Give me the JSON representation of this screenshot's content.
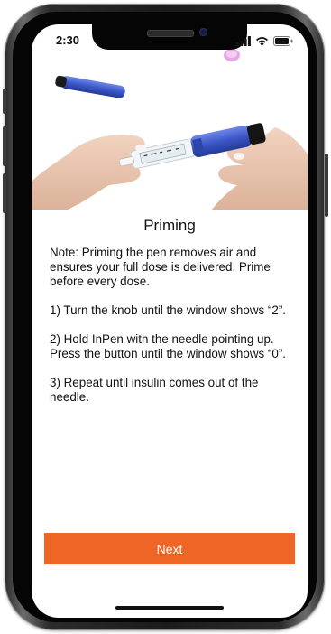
{
  "status_bar": {
    "time": "2:30",
    "signal_icon": "cellular-signal-icon",
    "wifi_icon": "wifi-icon",
    "battery_icon": "battery-icon"
  },
  "hero": {
    "image_description_icon": "insulin-pen-priming-photo"
  },
  "page": {
    "title": "Priming",
    "note": "Note: Priming the pen removes air and ensures your full dose is delivered. Prime before every dose.",
    "steps": [
      "1) Turn the knob until the window shows “2”.",
      "2) Hold InPen with the needle pointing up. Press the button until the window shows “0”.",
      "3) Repeat until insulin comes out of the needle."
    ]
  },
  "actions": {
    "next_label": "Next"
  },
  "colors": {
    "accent": "#ef6526",
    "pen_blue": "#3b57c8"
  }
}
